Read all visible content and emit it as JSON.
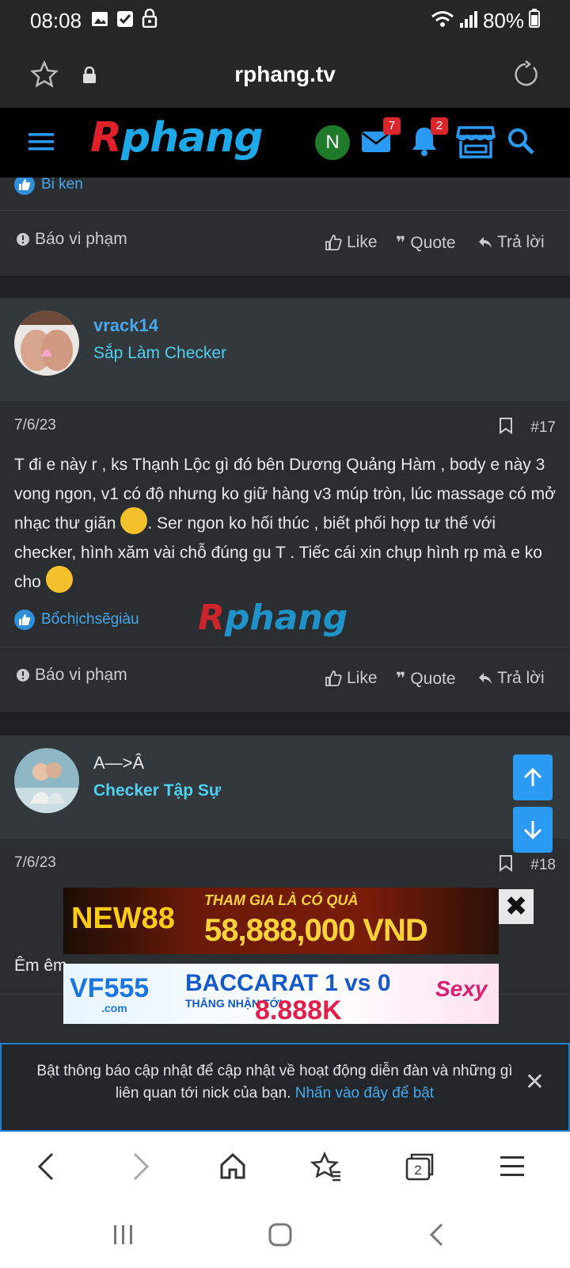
{
  "status_bar": {
    "time": "08:08",
    "battery": "80%"
  },
  "browser": {
    "url": "rphang.tv",
    "tabs_count": "2"
  },
  "site_header": {
    "logo_first": "R",
    "logo_rest": "phang",
    "user_initial": "N",
    "messages_badge": "7",
    "alerts_badge": "2"
  },
  "prev_post": {
    "reaction_user": "Bi ken",
    "report_label": "Báo vi phạm",
    "like_label": "Like",
    "quote_label": "Quote",
    "reply_label": "Trả lời"
  },
  "post17": {
    "username": "vrack14",
    "user_title": "Sắp Làm Checker",
    "date": "7/6/23",
    "number": "#17",
    "body_part1": "T đi e này r , ks Thạnh Lộc gì đó bên Dương Quảng Hàm , body e này 3 vong ngon, v1 có độ nhưng ko giữ hàng v3 múp tròn, lúc massage có mở nhạc thư giãn ",
    "body_part2": ". Ser ngon ko hối thúc , biết phối hợp tư thế với checker, hình xăm vài chỗ đúng gu T . Tiếc cái xin chụp hình rp mà e ko cho ",
    "reaction_user": "Bổchịchsẽgiàu",
    "report_label": "Báo vi phạm",
    "like_label": "Like",
    "quote_label": "Quote",
    "reply_label": "Trả lời"
  },
  "post18": {
    "username": "A—>Â",
    "user_title": "Checker Tập Sự",
    "date": "7/6/23",
    "number": "#18",
    "body": "Êm êm"
  },
  "watermark": {
    "first": "R",
    "rest": "phang"
  },
  "ads": {
    "ad1_logo_a": "NEW",
    "ad1_logo_b": "88",
    "ad1_top": "THAM GIA LÀ CÓ QUÀ",
    "ad1_amount": "58,888,000 VND",
    "ad2_logo": "VF555",
    "ad2_com": ".com",
    "ad2_head": "BACCARAT 1 vs 0",
    "ad2_sub": "THẮNG NHẬN TỚI",
    "ad2_amount": "8.888K",
    "ad2_brand": "Sexy",
    "close_symbol": "✖"
  },
  "notification": {
    "text": "Bật thông báo cập nhật để cập nhật về hoạt động diễn đàn và những gì liên quan tới nick của bạn. ",
    "link": "Nhấn vào đây để bật"
  },
  "colors": {
    "accent_blue": "#47a7eb",
    "title_cyan": "#4fd0f0",
    "badge_red": "#d8262b",
    "card_bg": "#2b2e31"
  }
}
